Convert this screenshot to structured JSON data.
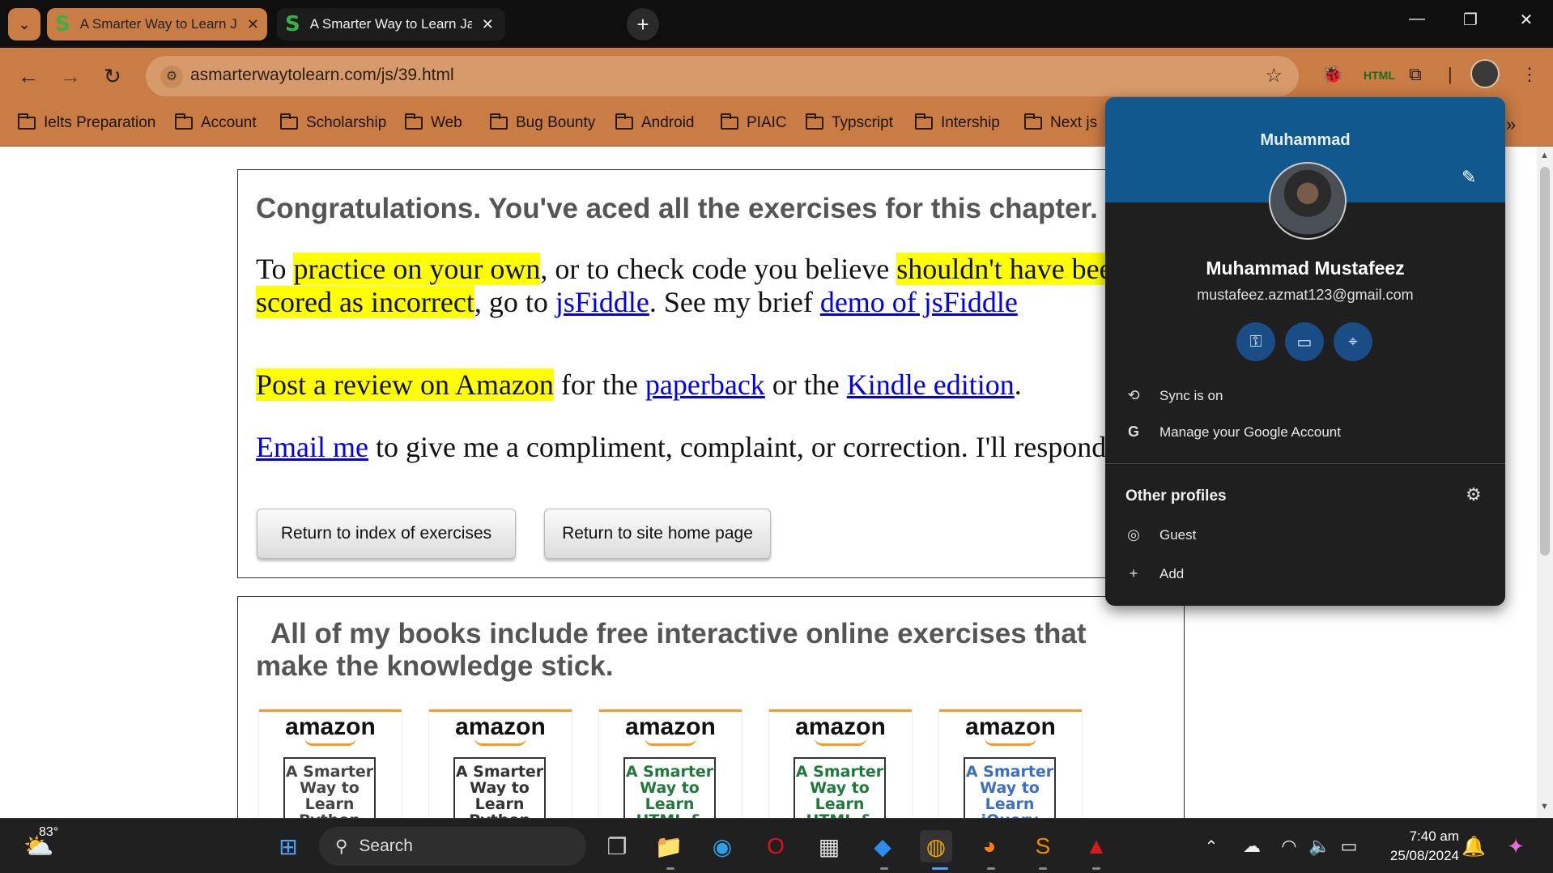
{
  "browser": {
    "tabs": [
      {
        "title": "A Smarter Way to Learn JavaScr",
        "favicon": "S",
        "active": true
      },
      {
        "title": "A Smarter Way to Learn JavaScr",
        "favicon": "S",
        "active": false
      }
    ],
    "url": "asmarterwaytolearn.com/js/39.html",
    "bookmarks": [
      "Ielts Preparation",
      "Account",
      "Scholarship",
      "Web",
      "Bug Bounty",
      "Android",
      "PIAIC",
      "Typscript",
      "Intership",
      "Next js"
    ]
  },
  "page": {
    "congrats": "Congratulations. You've aced all the exercises for this chapter.",
    "p1": {
      "t1": "To ",
      "hl1": "practice on your own",
      "t2": ", or to check code you believe ",
      "hl2": "shouldn't have been scored as incorrect",
      "t3": ", go to ",
      "link1": "jsFiddle",
      "t4": ". See my brief ",
      "link2": "demo of jsFiddle"
    },
    "p2": {
      "hl": "Post a review on Amazon",
      "t1": " for the ",
      "link1": "paperback",
      "t2": " or the ",
      "link2": "Kindle edition",
      "t3": "."
    },
    "p3": {
      "link": "Email me",
      "t1": " to give me a compliment, complaint, or correction. I'll respond."
    },
    "buttons": {
      "index": "Return to index of exercises",
      "home": "Return to site home page"
    },
    "books_heading": "All of my books include free interactive online exercises that make the knowledge stick.",
    "books": [
      {
        "brand": "amazon",
        "cover": "A Smarter Way to Learn Python",
        "color": "#444444"
      },
      {
        "brand": "amazon",
        "cover": "A Smarter Way to Learn Python",
        "color": "#333333"
      },
      {
        "brand": "amazon",
        "cover": "A Smarter Way to Learn HTML & CSS",
        "color": "#1f7a3a"
      },
      {
        "brand": "amazon",
        "cover": "A Smarter Way to Learn HTML & CSS",
        "color": "#1f7a3a"
      },
      {
        "brand": "amazon",
        "cover": "A Smarter Way to Learn jQuery",
        "color": "#3a6fc4"
      }
    ]
  },
  "profile": {
    "header_name": "Muhammad",
    "full_name": "Muhammad Mustafeez",
    "email": "mustafeez.azmat123@gmail.com",
    "sync": "Sync is on",
    "manage": "Manage your Google Account",
    "other_profiles": "Other profiles",
    "guest": "Guest",
    "add": "Add"
  },
  "taskbar": {
    "weather": "83°",
    "search": "Search",
    "time": "7:40 am",
    "date": "25/08/2024"
  },
  "colors": {
    "chrome_theme": "#c97c44",
    "profile_band": "#11588f",
    "highlight": "#ffff00",
    "link": "#0000ee"
  }
}
